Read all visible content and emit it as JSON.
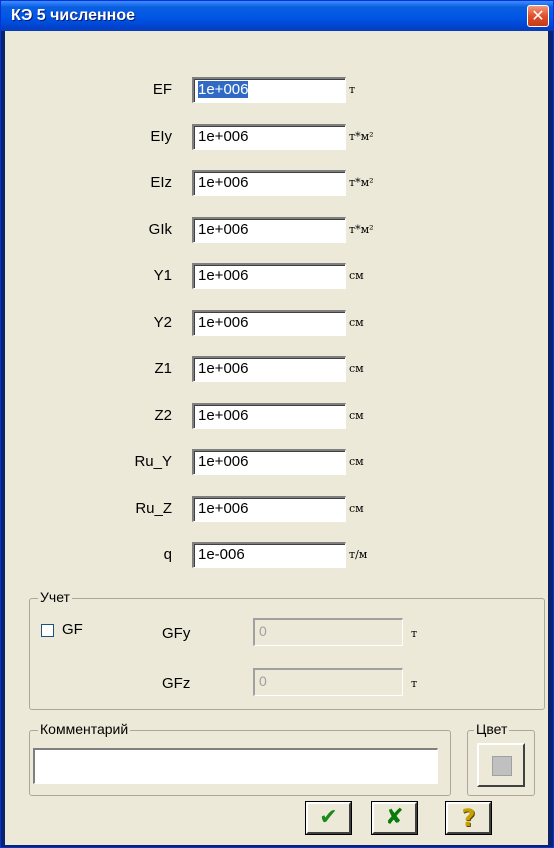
{
  "window": {
    "title": "КЭ 5 численное",
    "close_glyph": "✕"
  },
  "fields": [
    {
      "label": "EF",
      "value": "1e+006",
      "unit": "т",
      "selected": true
    },
    {
      "label": "EIy",
      "value": "1e+006",
      "unit": "т*м²"
    },
    {
      "label": "EIz",
      "value": "1e+006",
      "unit": "т*м²"
    },
    {
      "label": "GIk",
      "value": "1e+006",
      "unit": "т*м²"
    },
    {
      "label": "Y1",
      "value": "1e+006",
      "unit": "см"
    },
    {
      "label": "Y2",
      "value": "1e+006",
      "unit": "см"
    },
    {
      "label": "Z1",
      "value": "1e+006",
      "unit": "см"
    },
    {
      "label": "Z2",
      "value": "1e+006",
      "unit": "см"
    },
    {
      "label": "Ru_Y",
      "value": "1e+006",
      "unit": "см"
    },
    {
      "label": "Ru_Z",
      "value": "1e+006",
      "unit": "см"
    },
    {
      "label": "q",
      "value": "1e-006",
      "unit": "т/м"
    }
  ],
  "uchet": {
    "legend": "Учет",
    "gf_checkbox_label": "GF",
    "gf_checked": false,
    "gfy_label": "GFy",
    "gfy_value": "0",
    "gfy_unit": "т",
    "gfz_label": "GFz",
    "gfz_value": "0",
    "gfz_unit": "т"
  },
  "comment": {
    "legend": "Комментарий",
    "value": ""
  },
  "color": {
    "legend": "Цвет",
    "swatch": "#c0c0c0"
  },
  "buttons": {
    "ok_glyph": "✔",
    "ok_color": "#1a8a1a",
    "cancel_glyph": "✘",
    "cancel_color": "#0a7a0a",
    "help_glyph": "?",
    "help_color": "#c8a000"
  }
}
